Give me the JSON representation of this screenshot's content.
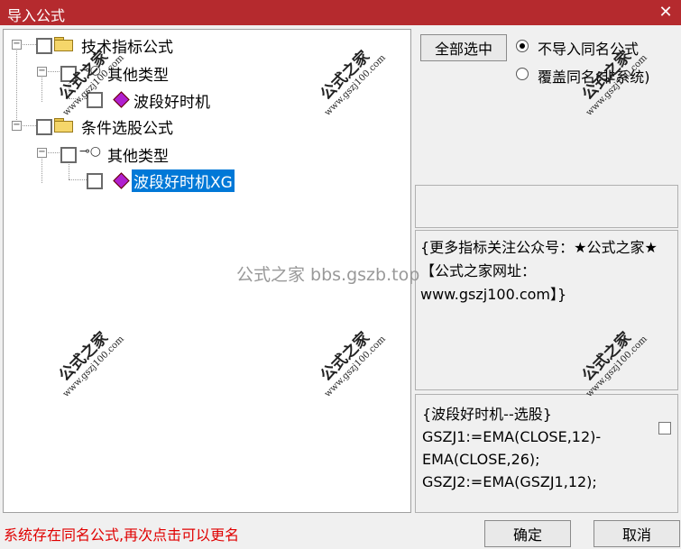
{
  "window": {
    "title": "导入公式",
    "close_glyph": "✕"
  },
  "tree": {
    "nodes": [
      {
        "label": "技术指标公式",
        "expander": "−"
      },
      {
        "label": "其他类型",
        "expander": "−"
      },
      {
        "label": "波段好时机"
      },
      {
        "label": "条件选股公式",
        "expander": "−"
      },
      {
        "label": "其他类型",
        "expander": "−"
      },
      {
        "label": "波段好时机XG",
        "selected": true
      }
    ]
  },
  "options": {
    "select_all_label": "全部选中",
    "radio_no_import": "不导入同名公式",
    "radio_overwrite": "覆盖同名(非系统)",
    "selected_radio": "radio_no_import"
  },
  "description": "{更多指标关注公众号：★公式之家★ 【公式之家网址：www.gszj100.com】}",
  "formula": "{波段好时机--选股}\nGSZJ1:=EMA(CLOSE,12)-EMA(CLOSE,26);\nGSZJ2:=EMA(GSZJ1,12);",
  "status": "系统存在同名公式,再次点击可以更名",
  "buttons": {
    "ok": "确定",
    "cancel": "取消"
  },
  "watermark": {
    "cn": "公式之家",
    "url": "www.gszj100.com",
    "center": "公式之家 bbs.gszb.top"
  }
}
